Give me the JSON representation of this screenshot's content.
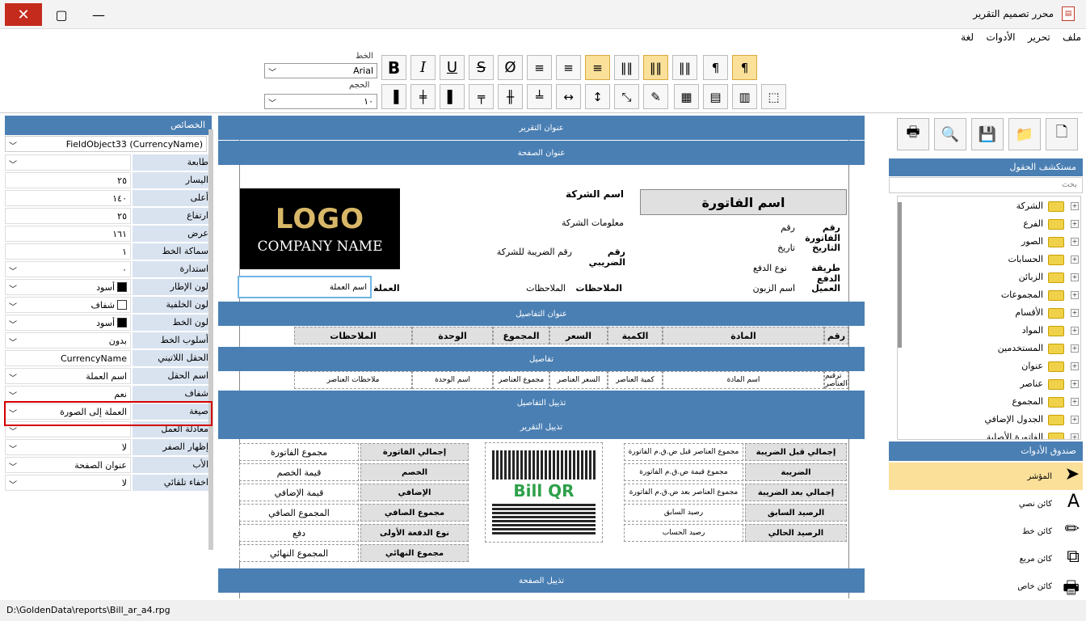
{
  "window": {
    "title": "محرر تصميم التقرير",
    "close": "✕",
    "max": "▢",
    "min": "—"
  },
  "menu": [
    "ملف",
    "تحرير",
    "الأدوات",
    "لغة"
  ],
  "toolbar": {
    "font_label": "الخط",
    "font_value": "Arial",
    "size_label": "الحجم",
    "size_value": "١٠"
  },
  "props": {
    "title": "الخصائص",
    "object": "FieldObject33 (CurrencyName)",
    "rows": [
      {
        "name": "طابعة",
        "value": "",
        "dd": true
      },
      {
        "name": "اليسار",
        "value": "٢٥"
      },
      {
        "name": "أعلى",
        "value": "١٤٠"
      },
      {
        "name": "ارتفاع",
        "value": "٢٥"
      },
      {
        "name": "عرض",
        "value": "١٦١"
      },
      {
        "name": "سماكة الخط",
        "value": "١"
      },
      {
        "name": "استدارة",
        "value": "٠",
        "dd": true
      },
      {
        "name": "لون الإطار",
        "value": "أسود",
        "dd": true,
        "swatch": "#000000"
      },
      {
        "name": "لون الخلفية",
        "value": "شفاف",
        "dd": true,
        "swatch": "#ffffff"
      },
      {
        "name": "لون الخط",
        "value": "أسود",
        "dd": true,
        "swatch": "#000000"
      },
      {
        "name": "أسلوب الخط",
        "value": "بدون",
        "dd": true
      },
      {
        "name": "الحقل اللاتيني",
        "value": "CurrencyName"
      },
      {
        "name": "اسم الحقل",
        "value": "اسم العملة",
        "dd": true
      },
      {
        "name": "شفاف",
        "value": "نعم",
        "dd": true
      },
      {
        "name": "صيغة",
        "value": "العملة إلى الصورة",
        "dd": true
      },
      {
        "name": "معادلة العمل",
        "value": "",
        "dd": true
      },
      {
        "name": "إظهار الصفر",
        "value": "لا",
        "dd": true
      },
      {
        "name": "الأب",
        "value": "عنوان الصفحة",
        "dd": true
      },
      {
        "name": "اخفاء تلقائي",
        "value": "لا",
        "dd": true
      }
    ]
  },
  "status": "D:\\GoldenData\\reports\\Bill_ar_a4.rpg",
  "canvas": {
    "bands": {
      "report_header": "عنوان التقرير",
      "page_header": "عنوان الصفحة",
      "details_header": "عنوان التفاصيل",
      "details": "تفاصيل",
      "details_footer": "تذييل التفاصيل",
      "report_footer": "تذييل التقرير",
      "page_footer": "تذييل الصفحة"
    },
    "logo": {
      "line1": "LOGO",
      "line2": "COMPANY NAME"
    },
    "company_name": "اسم الشركة",
    "company_info": "معلومات الشركة",
    "tax_label": "رقم الضريبي",
    "tax_value": "رقم الضريبة للشركة",
    "invoice_name": "اسم الفاتورة",
    "inv_no_label": "رقم الفاتورة",
    "inv_no_value": "رقم",
    "date_label": "التاريخ",
    "date_value": "تاريخ",
    "pay_label": "طريقة الدفع",
    "pay_value": "نوع الدفع",
    "client_label": "العميل",
    "client_value": "اسم الزبون",
    "notes_label": "الملاحظات",
    "notes_value": "الملاحظات",
    "currency_label": "العملة",
    "currency_value": "اسم العملة",
    "cols": [
      "رقم",
      "المادة",
      "الكمية",
      "السعر",
      "المجموع",
      "الوحدة",
      "الملاحظات"
    ],
    "detail_cells": [
      "ترقيم العناصر",
      "اسم المادة",
      "كمية العناصر",
      "السعر العناصر",
      "مجموع العناصر",
      "اسم الوحدة",
      "ملاحظات العناصر"
    ],
    "totals_left": [
      {
        "label": "إجمالي الفاتورة",
        "value": "مجموع الفاتورة"
      },
      {
        "label": "الخصم",
        "value": "قيمة الخصم"
      },
      {
        "label": "الإضافي",
        "value": "قيمة الإضافي"
      },
      {
        "label": "مجموع الصافي",
        "value": "المجموع الصافي"
      },
      {
        "label": "نوع الدفعة الأولى",
        "value": "دفع"
      },
      {
        "label": "مجموع النهائي",
        "value": "المجموع النهائي"
      }
    ],
    "totals_right": [
      {
        "label": "إجمالي قبل الضريبة",
        "value": "مجموع العناصر قبل ض.ق.م الفاتورة"
      },
      {
        "label": "الضريبة",
        "value": "مجموع قيمة ض.ق.م الفاتورة"
      },
      {
        "label": "إجمالي بعد الضريبة",
        "value": "مجموع العناصر بعد ض.ق.م الفاتورة"
      },
      {
        "label": "الرصيد السابق",
        "value": "رصيد السابق"
      },
      {
        "label": "الرصيد الحالي",
        "value": "رصيد الحساب"
      }
    ],
    "qr_text": "Bill QR"
  },
  "right": {
    "fields_title": "مستكشف الحقول",
    "search": "بحث",
    "tree": [
      "الشركة",
      "الفرع",
      "الصور",
      "الحسابات",
      "الزبائن",
      "المجموعات",
      "الأقسام",
      "المواد",
      "المستخدمين",
      "عنوان",
      "عناصر",
      "المجموع",
      "الجدول الإضافي",
      "الفاتورة الأصلية"
    ],
    "toolbox_title": "صندوق الأدوات",
    "tools": [
      "المؤشر",
      "كائن نصي",
      "كائن خط",
      "كائن مربع",
      "كائن خاص"
    ]
  }
}
